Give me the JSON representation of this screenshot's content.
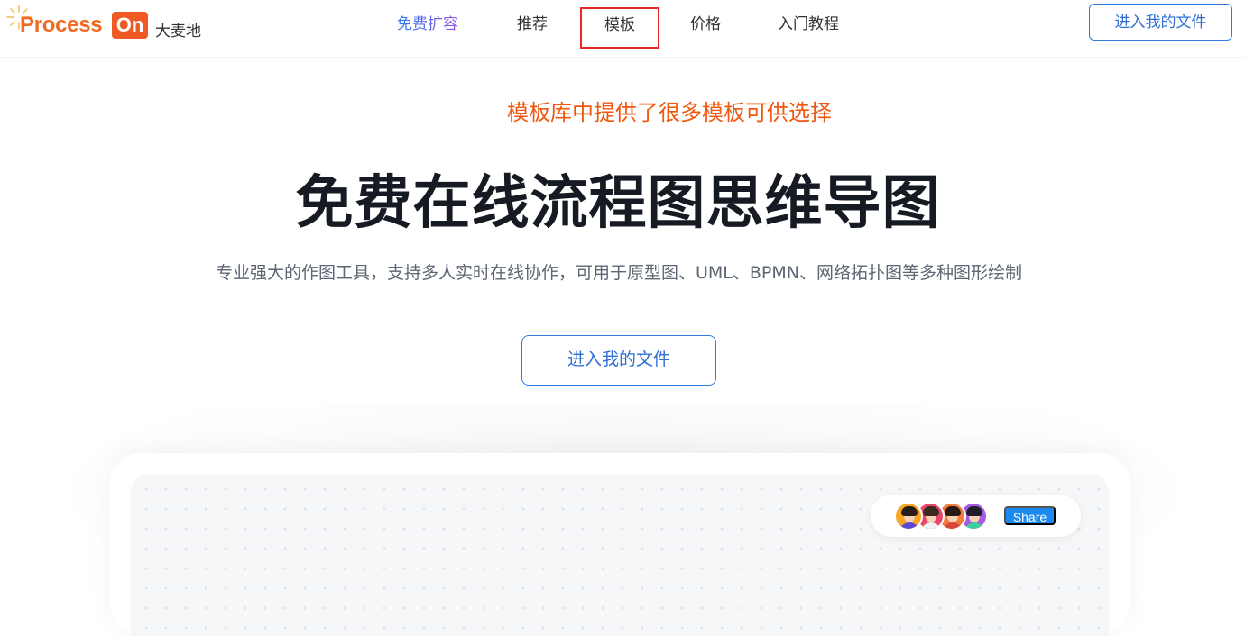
{
  "header": {
    "logo": {
      "main": "Process",
      "badge": "On",
      "sub": "大麦地"
    },
    "nav": [
      {
        "label": "免费扩容",
        "highlight": true
      },
      {
        "label": "推荐"
      },
      {
        "label": "模板",
        "boxed": true
      },
      {
        "label": "价格"
      },
      {
        "label": "入门教程"
      }
    ],
    "files_button": "进入我的文件"
  },
  "annotation": "模板库中提供了很多模板可供选择",
  "hero": {
    "title": "免费在线流程图思维导图",
    "subtitle": "专业强大的作图工具，支持多人实时在线协作，可用于原型图、UML、BPMN、网络拓扑图等多种图形绘制",
    "cta": "进入我的文件"
  },
  "preview": {
    "collaborators": [
      {
        "name": "avatar-1",
        "bg": "#f6a623",
        "hair": "#2a1c16",
        "shirt": "#5b4ad6"
      },
      {
        "name": "avatar-2",
        "bg": "#e8476b",
        "hair": "#3b2a22",
        "shirt": "#f2f2f2"
      },
      {
        "name": "avatar-3",
        "bg": "#f17e3a",
        "hair": "#2b1a14",
        "shirt": "#d6463a"
      },
      {
        "name": "avatar-4",
        "bg": "#a55ce0",
        "hair": "#1f1f2a",
        "shirt": "#3ecf9b"
      }
    ],
    "share_label": "Share"
  },
  "colors": {
    "brand_orange": "#ef6a23",
    "accent_blue": "#2f7ce0",
    "annotation_red": "#f0570f",
    "highlight_box": "#e82727"
  }
}
